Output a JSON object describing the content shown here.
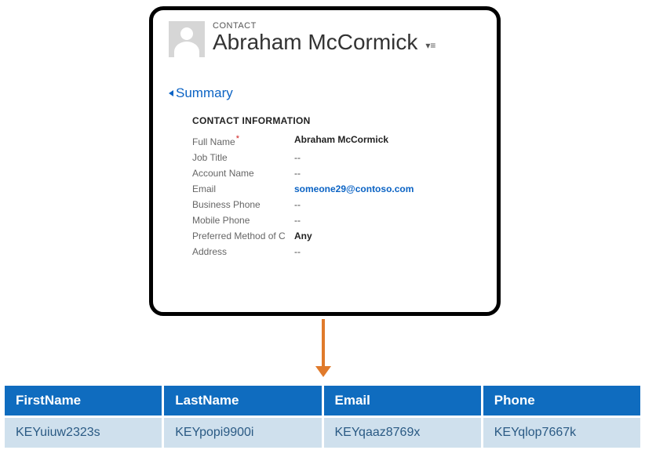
{
  "contact_card": {
    "entity_label": "CONTACT",
    "name": "Abraham McCormick",
    "summary_label": "Summary",
    "section_title": "CONTACT INFORMATION",
    "fields": {
      "full_name": {
        "label": "Full Name",
        "value": "Abraham McCormick",
        "required": true,
        "style": "plain"
      },
      "job_title": {
        "label": "Job Title",
        "value": "--",
        "required": false,
        "style": "dash"
      },
      "account": {
        "label": "Account Name",
        "value": "--",
        "required": false,
        "style": "dash"
      },
      "email": {
        "label": "Email",
        "value": "someone29@contoso.com",
        "required": false,
        "style": "link"
      },
      "bus_phone": {
        "label": "Business Phone",
        "value": "--",
        "required": false,
        "style": "dash"
      },
      "mob_phone": {
        "label": "Mobile Phone",
        "value": "--",
        "required": false,
        "style": "dash"
      },
      "pref": {
        "label": "Preferred Method of C",
        "value": "Any",
        "required": false,
        "style": "plain"
      },
      "address": {
        "label": "Address",
        "value": "--",
        "required": false,
        "style": "dash"
      }
    }
  },
  "mapping_table": {
    "columns": [
      "FirstName",
      "LastName",
      "Email",
      "Phone"
    ],
    "row": [
      "KEYuiuw2323s",
      "KEYpopi9900i",
      "KEYqaaz8769x",
      "KEYqlop7667k"
    ]
  }
}
